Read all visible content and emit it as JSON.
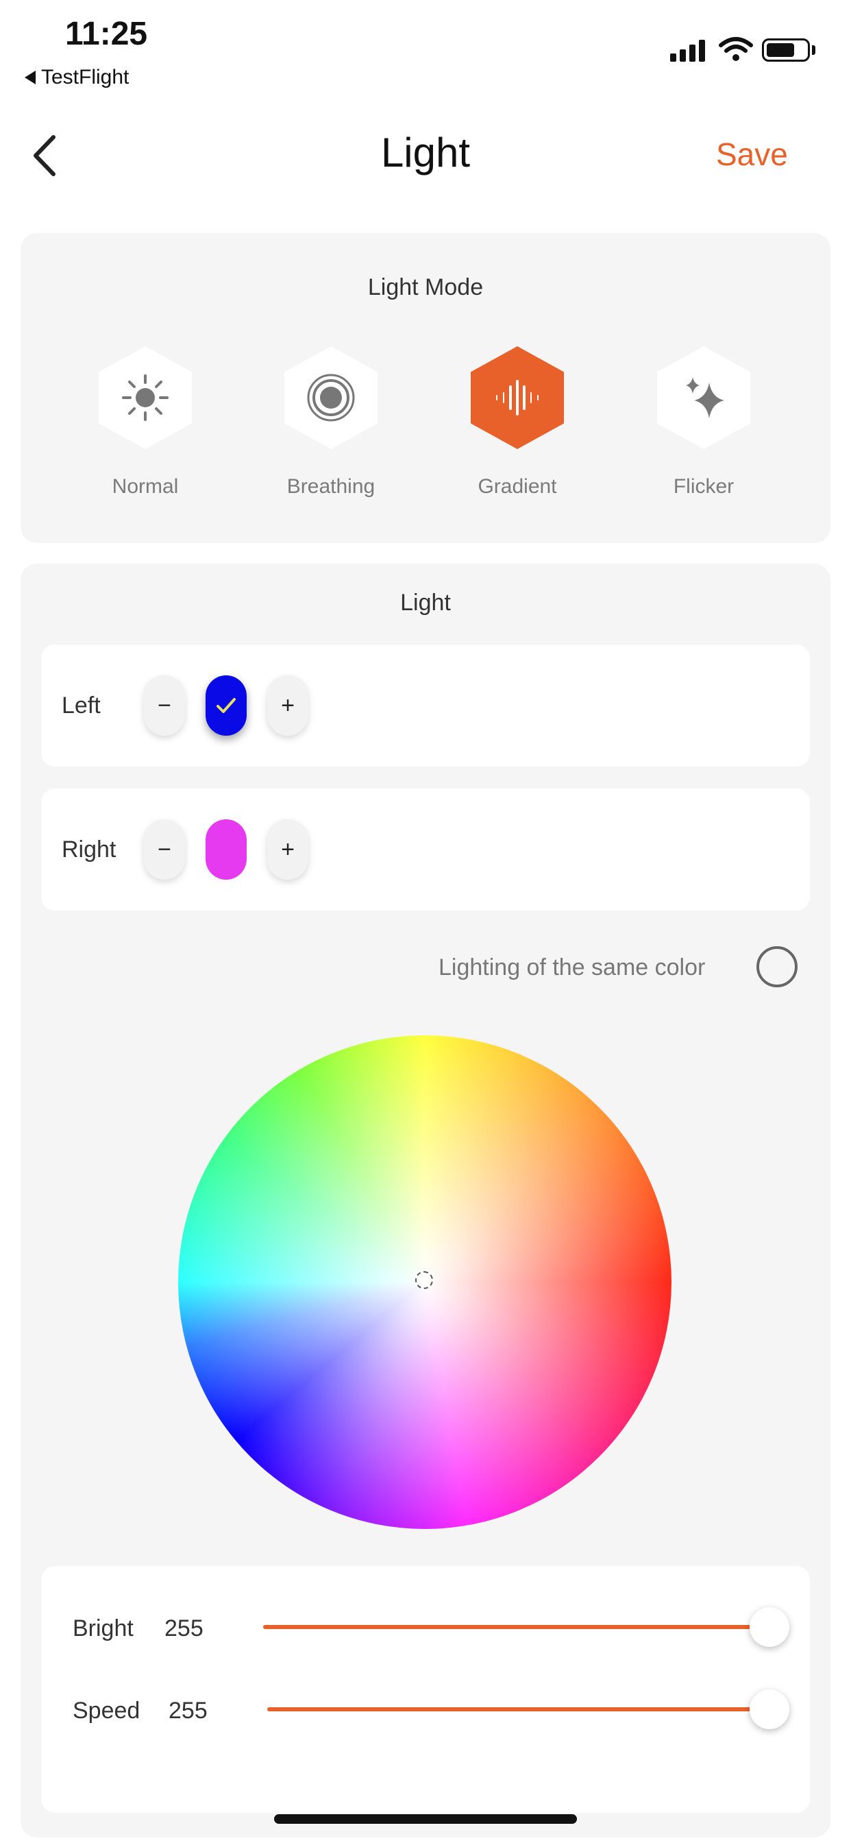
{
  "status_bar": {
    "time": "11:25",
    "back_app": "TestFlight",
    "icons": [
      "signal-icon",
      "wifi-icon",
      "battery-icon"
    ]
  },
  "nav": {
    "title": "Light",
    "save_label": "Save",
    "back_icon": "chevron-left-icon"
  },
  "light_mode": {
    "title": "Light Mode",
    "selected": "Gradient",
    "modes": [
      {
        "label": "Normal",
        "icon": "sun-icon",
        "active": false
      },
      {
        "label": "Breathing",
        "icon": "breathing-icon",
        "active": false
      },
      {
        "label": "Gradient",
        "icon": "waveform-icon",
        "active": true
      },
      {
        "label": "Flicker",
        "icon": "sparkle-icon",
        "active": false
      }
    ]
  },
  "light": {
    "title": "Light",
    "left": {
      "label": "Left",
      "minus": "−",
      "plus": "+",
      "color": "#0A0AE6",
      "selected": true
    },
    "right": {
      "label": "Right",
      "minus": "−",
      "plus": "+",
      "color": "#E53AF0",
      "selected": false
    },
    "same_color_label": "Lighting of the same color",
    "same_color_checked": false
  },
  "sliders": {
    "bright": {
      "label": "Bright",
      "value": "255",
      "max": 255
    },
    "speed": {
      "label": "Speed",
      "value": "255",
      "max": 255
    }
  },
  "colors": {
    "accent": "#E8612B",
    "card_bg": "#F5F5F5",
    "icon_gray": "#7a7a7a"
  }
}
